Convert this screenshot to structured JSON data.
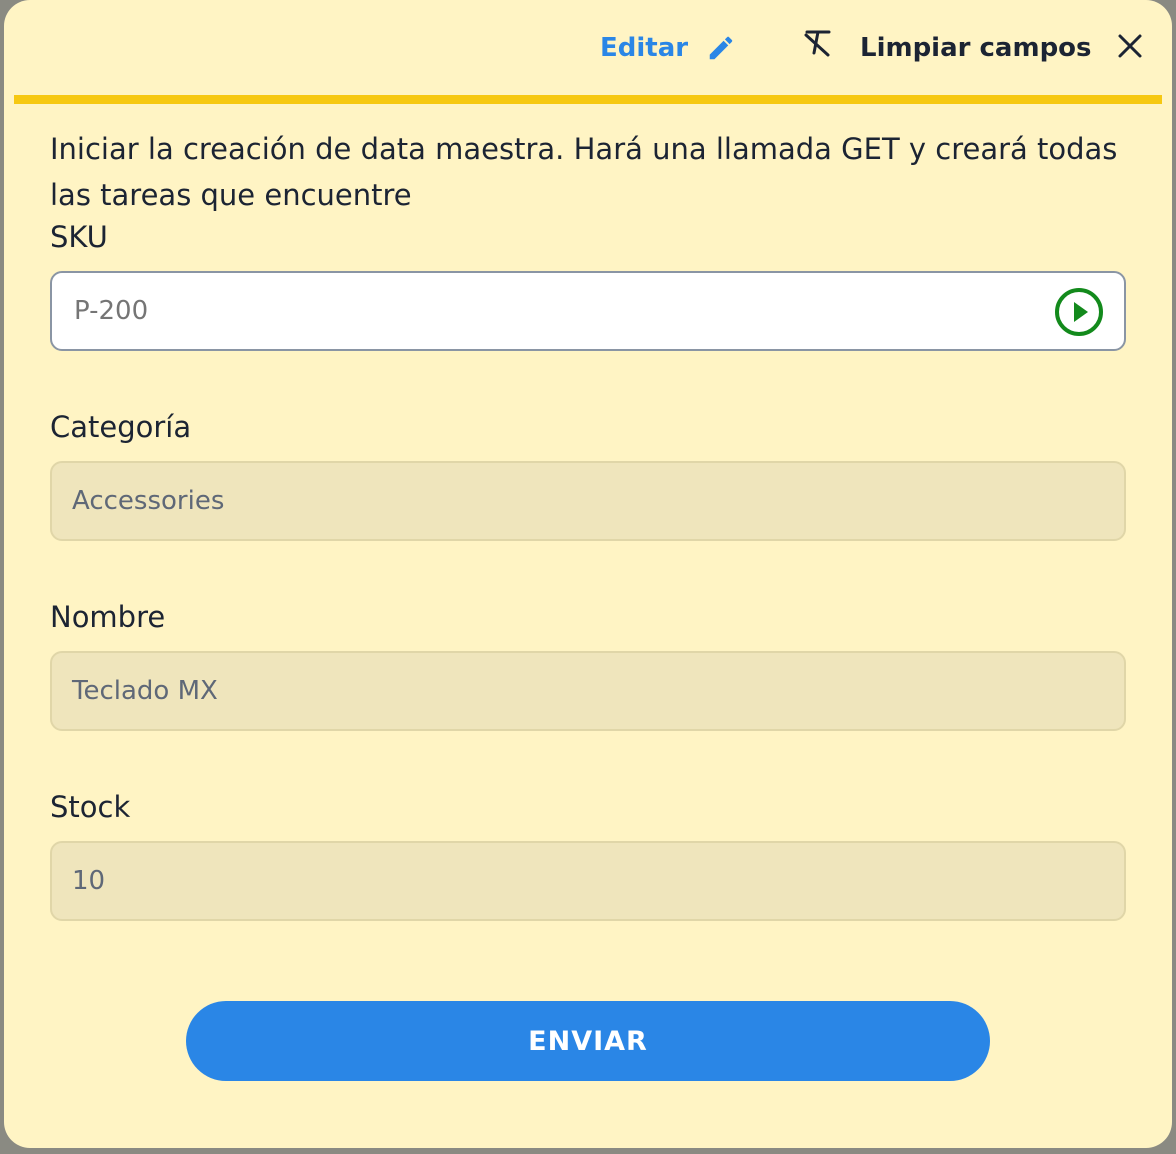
{
  "header": {
    "edit_label": "Editar",
    "clear_label": "Limpiar campos",
    "icons": {
      "edit": "pencil-icon",
      "clear": "clear-format-icon",
      "close": "close-icon"
    }
  },
  "description": "Iniciar la creación de data maestra. Hará una llamada GET y creará todas las tareas que encuentre",
  "fields": {
    "sku": {
      "label": "SKU",
      "placeholder": "P-200",
      "action_icon": "play-circle-icon"
    },
    "category": {
      "label": "Categoría",
      "value": "Accessories"
    },
    "name": {
      "label": "Nombre",
      "value": "Teclado MX"
    },
    "stock": {
      "label": "Stock",
      "value": "10"
    }
  },
  "submit_label": "ENVIAR",
  "colors": {
    "background": "#fff4c4",
    "accent_line": "#f6c812",
    "primary": "#2a86e6",
    "play_icon": "#138a1c",
    "text": "#1c2433"
  }
}
